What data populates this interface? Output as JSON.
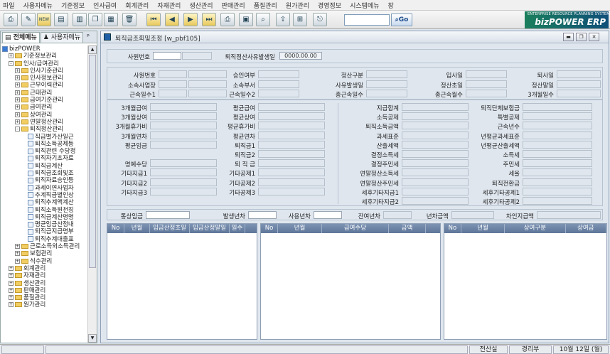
{
  "menu": [
    "파일",
    "사용자메뉴",
    "기준정보",
    "인사급여",
    "회계관리",
    "자재관리",
    "생산관리",
    "판매관리",
    "품질관리",
    "원가관리",
    "경영정보",
    "시스템메뉴",
    "창"
  ],
  "toolbar": {
    "search_value": "",
    "go_label": "Go",
    "new_badge": "NEW"
  },
  "logo": {
    "line1": "ENTERPRISE RESOURCE PLANNING SYSTEM",
    "line2": "bizPOWER ERP"
  },
  "sidebar": {
    "tabs": [
      "전체메뉴",
      "사용자메뉴"
    ],
    "pin": "ᵖ",
    "tree": [
      {
        "label": "bizPOWER",
        "level": 0,
        "type": "root"
      },
      {
        "label": "기준정보관리",
        "level": 1,
        "type": "folder",
        "exp": "+"
      },
      {
        "label": "인사/급여관리",
        "level": 1,
        "type": "folder",
        "exp": "-"
      },
      {
        "label": "인사기준관리",
        "level": 2,
        "type": "folder",
        "exp": "+"
      },
      {
        "label": "인사정보관리",
        "level": 2,
        "type": "folder",
        "exp": "+"
      },
      {
        "label": "근무이력관리",
        "level": 2,
        "type": "folder",
        "exp": "+"
      },
      {
        "label": "근태관리",
        "level": 2,
        "type": "folder",
        "exp": "+"
      },
      {
        "label": "급여기준관리",
        "level": 2,
        "type": "folder",
        "exp": "+"
      },
      {
        "label": "급여관리",
        "level": 2,
        "type": "folder",
        "exp": "+"
      },
      {
        "label": "상여관리",
        "level": 2,
        "type": "folder",
        "exp": "+"
      },
      {
        "label": "연말정산관리",
        "level": 2,
        "type": "folder",
        "exp": "+"
      },
      {
        "label": "퇴직정산관리",
        "level": 2,
        "type": "folder",
        "exp": "-"
      },
      {
        "label": "직급별가산일근",
        "level": 3,
        "type": "page"
      },
      {
        "label": "퇴직소득공제등",
        "level": 3,
        "type": "page"
      },
      {
        "label": "퇴직관련 수당정",
        "level": 3,
        "type": "page"
      },
      {
        "label": "퇴직자기초자료",
        "level": 3,
        "type": "page"
      },
      {
        "label": "퇴직금계산",
        "level": 3,
        "type": "page"
      },
      {
        "label": "퇴직금조회및조",
        "level": 3,
        "type": "page",
        "sel": true
      },
      {
        "label": "퇴직자료승인등",
        "level": 3,
        "type": "page"
      },
      {
        "label": "과세이연사업자",
        "level": 3,
        "type": "page"
      },
      {
        "label": "추계직급별인상",
        "level": 3,
        "type": "page"
      },
      {
        "label": "퇴직추계액계산",
        "level": 3,
        "type": "page"
      },
      {
        "label": "퇴직소득원천징",
        "level": 3,
        "type": "page"
      },
      {
        "label": "퇴직금계산명명",
        "level": 3,
        "type": "page"
      },
      {
        "label": "평균임금산정내",
        "level": 3,
        "type": "page"
      },
      {
        "label": "퇴직금지급명부",
        "level": 3,
        "type": "page"
      },
      {
        "label": "퇴직추계대출표",
        "level": 3,
        "type": "page"
      },
      {
        "label": "근로소득외소득관리",
        "level": 2,
        "type": "folder",
        "exp": "+"
      },
      {
        "label": "보험관리",
        "level": 2,
        "type": "folder",
        "exp": "+"
      },
      {
        "label": "식수관리",
        "level": 2,
        "type": "folder",
        "exp": "+"
      },
      {
        "label": "회계관리",
        "level": 1,
        "type": "folder",
        "exp": "+"
      },
      {
        "label": "자재관리",
        "level": 1,
        "type": "folder",
        "exp": "+"
      },
      {
        "label": "생산관리",
        "level": 1,
        "type": "folder",
        "exp": "+"
      },
      {
        "label": "판매관리",
        "level": 1,
        "type": "folder",
        "exp": "+"
      },
      {
        "label": "품질관리",
        "level": 1,
        "type": "folder",
        "exp": "+"
      },
      {
        "label": "원가관리",
        "level": 1,
        "type": "folder",
        "exp": "+"
      }
    ]
  },
  "window": {
    "title": "퇴직금조회및조정 [w_pbf105]",
    "min": "▬",
    "restore": "❐",
    "close": "✕"
  },
  "filter": {
    "emp_label": "사원번호",
    "date_label": "퇴직정산사유발생일",
    "date_value": "0000.00.00"
  },
  "info_labels": {
    "c1": [
      "사원번호",
      "소속사업장",
      "근속일수1"
    ],
    "c2": [
      "승인여부",
      "소속부서",
      "근속일수2"
    ],
    "c3": [
      "정산구분",
      "사유발생일",
      "총근속일수"
    ],
    "c4": [
      "입사일",
      "정산초일",
      "총근속월수"
    ],
    "c5": [
      "퇴사일",
      "정산말일",
      "3개월일수"
    ]
  },
  "calc_labels": {
    "c1": [
      "3개월급여",
      "3개월상여",
      "3개월휴가비",
      "3개월연차",
      "평균임금",
      "명예수당",
      "기타지급1",
      "기타지급2",
      "기타지급3"
    ],
    "c2": [
      "평균급여",
      "평균상여",
      "평균휴가비",
      "평균연차",
      "퇴직금1",
      "퇴직금2",
      "퇴 직 금",
      "기타공제1",
      "기타공제2",
      "기타공제3"
    ],
    "c3": [
      "지급합계",
      "소득공제",
      "퇴직소득금액",
      "과세표준",
      "산출세액",
      "결정소득세",
      "결정주민세",
      "연말정산소득세",
      "연말정산주민세",
      "세후기타지급1",
      "세후기타지급2"
    ],
    "c4": [
      "퇴직단체보험금",
      "특별공제",
      "근속년수",
      "년평균과세표준",
      "년평균산출세액",
      "소득세",
      "주민세",
      "세율",
      "퇴직전환금",
      "세후기타공제1",
      "세후기타공제2"
    ]
  },
  "summary": {
    "labels": [
      "통상임금",
      "발생년차",
      "사용년차",
      "잔여년차",
      "년차금액",
      "차인지급액"
    ]
  },
  "grids": {
    "g1": [
      "No",
      "년월",
      "임금산정초일",
      "임금산정말일",
      "일수"
    ],
    "g2": [
      "No",
      "년월",
      "급여수당",
      "금액"
    ],
    "g3": [
      "No",
      "년월",
      "상여구분",
      "상여금"
    ]
  },
  "status": {
    "user": "전산실",
    "dept": "경리부",
    "date": "10월 12일 (월)"
  }
}
